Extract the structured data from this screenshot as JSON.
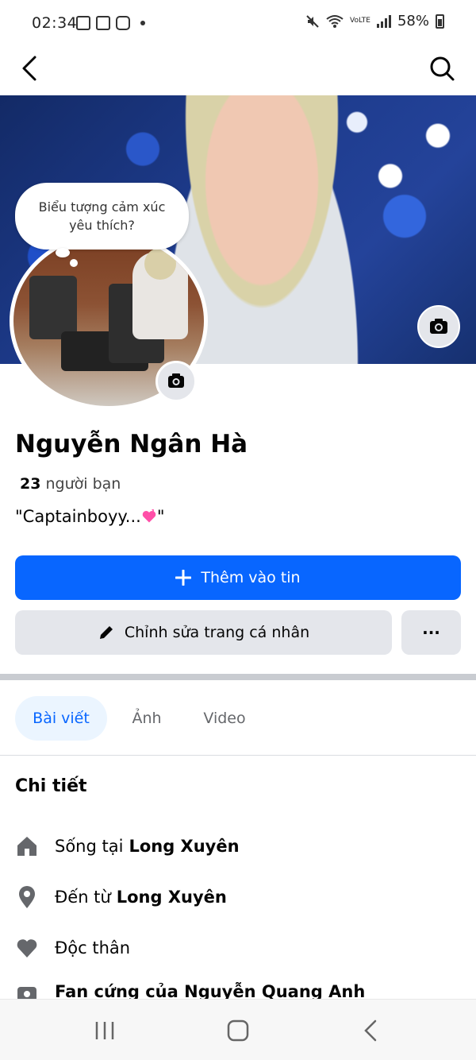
{
  "status": {
    "time": "02:34",
    "battery": "58%",
    "network": "VoLTE"
  },
  "profile": {
    "name": "Nguyễn Ngân Hà",
    "friends_count": "23",
    "friends_label": "người bạn",
    "bio": "\"Captainboyy...",
    "bio_end": "\""
  },
  "bubble": {
    "line1": "Biểu tượng cảm xúc",
    "line2": "yêu thích?"
  },
  "actions": {
    "add_story": "Thêm vào tin",
    "edit_profile": "Chỉnh sửa trang cá nhân",
    "more": "···"
  },
  "tabs": [
    {
      "label": "Bài viết",
      "active": true
    },
    {
      "label": "Ảnh",
      "active": false
    },
    {
      "label": "Video",
      "active": false
    }
  ],
  "details": {
    "title": "Chi tiết",
    "items": [
      {
        "prefix": "Sống tại",
        "value": "Long Xuyên",
        "icon": "home-icon"
      },
      {
        "prefix": "Đến từ",
        "value": "Long Xuyên",
        "icon": "location-pin-icon"
      },
      {
        "prefix": "Độc thân",
        "value": "",
        "icon": "heart-icon"
      },
      {
        "prefix": "Fan cứng của Nguyễn Quang Anh",
        "value": "",
        "icon": "badge-icon"
      }
    ]
  },
  "colors": {
    "primary": "#0866ff",
    "secondary_bg": "#e4e6eb",
    "tab_active_bg": "#ebf5ff"
  }
}
